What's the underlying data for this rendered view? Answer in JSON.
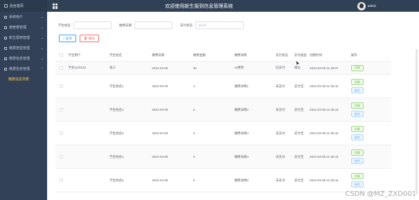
{
  "header": {
    "brand": "后台首页",
    "title": "欢迎使用新生报到信息管理系统",
    "username": "admin"
  },
  "sidebar": {
    "items": [
      {
        "label": "系统用户"
      },
      {
        "label": "宿舍楼管理"
      },
      {
        "label": "新生报到管理"
      },
      {
        "label": "缴费类型管理"
      },
      {
        "label": "缴费信息管理"
      },
      {
        "label": "缴费信息管理"
      },
      {
        "label": "缴费信息列表"
      }
    ]
  },
  "filters": {
    "student_name_label": "学生姓名",
    "pay_date_label": "缴费日期",
    "status_label": "支付状态",
    "status_placeholder": "请选择"
  },
  "buttons": {
    "search": "查询",
    "delete": "删除"
  },
  "table": {
    "headers": [
      "学生用户",
      "学生姓名",
      "缴费日期",
      "缴费金额",
      "缴费详情",
      "支付状态",
      "支付类型",
      "创建时间",
      "操作"
    ],
    "ops": {
      "detail": "详情",
      "pay": "支付"
    },
    "rows": [
      {
        "user": "学生1(20123",
        "name": "张三",
        "date": "2024-03-08",
        "amount": "30",
        "detail": "xx费用",
        "status": "已支付",
        "pay_type": "微信",
        "created": "2024-03-08 11:46:07"
      },
      {
        "user": "",
        "name": "学生姓名1",
        "date": "2024-03-08",
        "amount": "1",
        "detail": "缴费详情1",
        "status": "未支付",
        "pay_type": "支付宝",
        "created": "2024-03-08 11:35:44"
      },
      {
        "user": "",
        "name": "学生姓名2",
        "date": "2024-03-08",
        "amount": "2",
        "detail": "缴费详情2",
        "status": "未支付",
        "pay_type": "支付宝",
        "created": "2024-03-08 11:35:44"
      },
      {
        "user": "",
        "name": "学生姓名3",
        "date": "2024-03-08",
        "amount": "3",
        "detail": "缴费详情3",
        "status": "未支付",
        "pay_type": "支付宝",
        "created": "2024-03-08 11:35:44"
      },
      {
        "user": "",
        "name": "学生姓名4",
        "date": "2024-03-08",
        "amount": "4",
        "detail": "缴费详情4",
        "status": "未支付",
        "pay_type": "支付宝",
        "created": "2024-03-08 11:35:44"
      },
      {
        "user": "",
        "name": "学生姓名5",
        "date": "2024-03-08",
        "amount": "5",
        "detail": "缴费详情5",
        "status": "未支付",
        "pay_type": "支付宝",
        "created": "2024-03-08 11:35:44"
      }
    ]
  },
  "watermark": "CSDN @MZ_ZXD001"
}
